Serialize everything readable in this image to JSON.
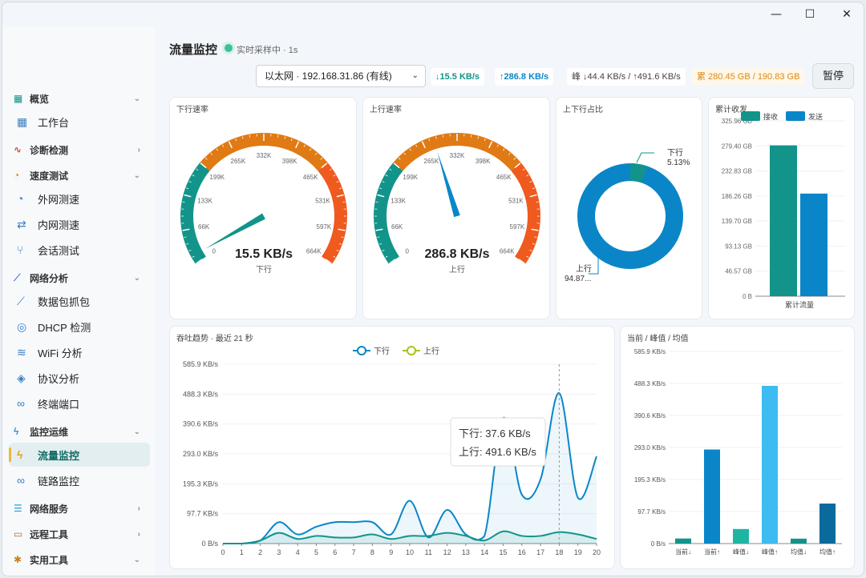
{
  "window": {
    "min": "—",
    "max": "☐",
    "close": "✕"
  },
  "sidebar": {
    "groups": [
      {
        "label": "概览",
        "chev": "⌄",
        "items": [
          {
            "label": "工作台"
          }
        ]
      },
      {
        "label": "诊断检测",
        "chev": "›",
        "items": []
      },
      {
        "label": "速度测试",
        "chev": "⌄",
        "items": [
          {
            "label": "外网测速"
          },
          {
            "label": "内网测速"
          },
          {
            "label": "会话测试"
          }
        ]
      },
      {
        "label": "网络分析",
        "chev": "⌄",
        "items": [
          {
            "label": "数据包抓包"
          },
          {
            "label": "DHCP 检测"
          },
          {
            "label": "WiFi 分析"
          },
          {
            "label": "协议分析"
          },
          {
            "label": "终端端口"
          }
        ]
      },
      {
        "label": "监控运维",
        "chev": "⌄",
        "items": [
          {
            "label": "流量监控"
          },
          {
            "label": "链路监控"
          }
        ]
      },
      {
        "label": "网络服务",
        "chev": "›",
        "items": []
      },
      {
        "label": "远程工具",
        "chev": "›",
        "items": []
      },
      {
        "label": "实用工具",
        "chev": "⌄",
        "items": []
      }
    ]
  },
  "header": {
    "title": "流量监控",
    "live": "实时采样中 · 1s",
    "interface": "以太网 · 192.168.31.86 (有线)",
    "down_rate": "↓15.5 KB/s",
    "up_rate": "↑286.8 KB/s",
    "peak": "峰 ↓44.4 KB/s / ↑491.6 KB/s",
    "total": "累 280.45 GB / 190.83 GB",
    "pause": "暂停"
  },
  "colors": {
    "teal": "#12948a",
    "blue": "#0a86c8",
    "orange": "#e07a14",
    "red": "#ef5a1f",
    "green": "#a3c51d"
  },
  "gauge_down": {
    "title": "下行速率",
    "value": "15.5 KB/s",
    "label": "下行",
    "fraction": 0.0234,
    "ticks": [
      "0",
      "66K",
      "133K",
      "199K",
      "265K",
      "332K",
      "398K",
      "465K",
      "531K",
      "597K",
      "664K"
    ]
  },
  "gauge_up": {
    "title": "上行速率",
    "value": "286.8 KB/s",
    "label": "上行",
    "fraction": 0.432,
    "ticks": [
      "0",
      "66K",
      "133K",
      "199K",
      "265K",
      "332K",
      "398K",
      "465K",
      "531K",
      "597K",
      "664K"
    ]
  },
  "donut": {
    "title": "上下行占比",
    "down_label": "下行",
    "down_pct": "5.13%",
    "up_label": "上行",
    "up_pct": "94.87...",
    "down_fraction": 0.0513
  },
  "chart_data": [
    {
      "type": "bar",
      "title": "累计收发",
      "categories": [
        "累计流量"
      ],
      "series": [
        {
          "name": "接收",
          "values": [
            280.45
          ]
        },
        {
          "name": "发送",
          "values": [
            190.83
          ]
        }
      ],
      "ylim": [
        0,
        325.96
      ],
      "yticks": [
        "0 B",
        "46.57 GB",
        "93.13 GB",
        "139.70 GB",
        "186.26 GB",
        "232.83 GB",
        "279.40 GB",
        "325.96 GB"
      ]
    },
    {
      "type": "area",
      "title": "吞吐趋势 · 最近 21 秒",
      "x": [
        0,
        1,
        2,
        3,
        4,
        5,
        6,
        7,
        8,
        9,
        10,
        11,
        12,
        13,
        14,
        15,
        16,
        17,
        18,
        19,
        20
      ],
      "series": [
        {
          "name": "下行",
          "values": [
            0,
            0,
            10,
            70,
            30,
            55,
            70,
            70,
            70,
            30,
            140,
            20,
            110,
            30,
            25,
            410,
            160,
            210,
            491.6,
            150,
            285
          ]
        },
        {
          "name": "上行",
          "values": [
            0,
            0,
            10,
            35,
            15,
            25,
            20,
            20,
            30,
            15,
            25,
            25,
            35,
            25,
            10,
            40,
            25,
            25,
            37.6,
            30,
            15
          ]
        }
      ],
      "ylim": [
        0,
        585.9
      ],
      "yticks": [
        "0 B/s",
        "97.7 KB/s",
        "195.3 KB/s",
        "293.0 KB/s",
        "390.6 KB/s",
        "488.3 KB/s",
        "585.9 KB/s"
      ],
      "tooltip": {
        "down": "下行: 37.6 KB/s",
        "up": "上行: 491.6 KB/s",
        "x": 18
      }
    },
    {
      "type": "bar",
      "title": "当前 / 峰值 / 均值",
      "categories": [
        "当前↓",
        "当前↑",
        "峰值↓",
        "峰值↑",
        "均值↓",
        "均值↑"
      ],
      "values": [
        15.5,
        286.8,
        44.4,
        481,
        15,
        122
      ],
      "ylim": [
        0,
        585.9
      ],
      "yticks": [
        "0 B/s",
        "97.7 KB/s",
        "195.3 KB/s",
        "293.0 KB/s",
        "390.6 KB/s",
        "488.3 KB/s",
        "585.9 KB/s"
      ],
      "bar_colors": [
        "#12948a",
        "#0a86c8",
        "#1fb5a3",
        "#3cbcf0",
        "#12948a",
        "#0a6a9c"
      ]
    }
  ]
}
